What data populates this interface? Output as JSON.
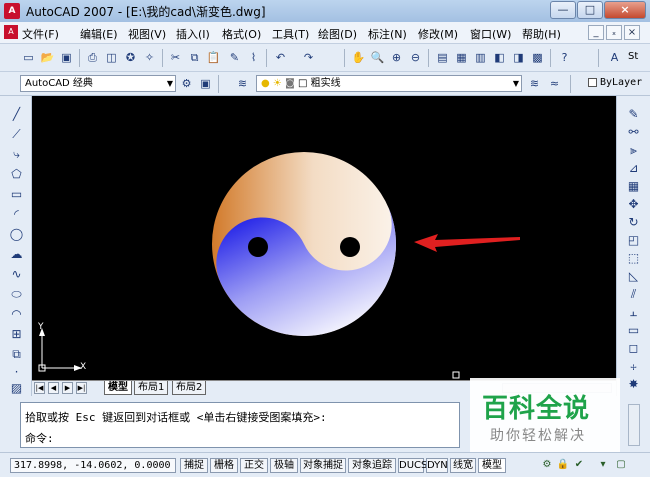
{
  "window": {
    "title": "AutoCAD 2007 - [E:\\我的cad\\渐变色.dwg]",
    "app_icon": "autocad-logo",
    "controls": [
      "—",
      "□",
      "×"
    ]
  },
  "menu": {
    "items": [
      "文件(F)",
      "编辑(E)",
      "视图(V)",
      "插入(I)",
      "格式(O)",
      "工具(T)",
      "绘图(D)",
      "标注(N)",
      "修改(M)",
      "窗口(W)",
      "帮助(H)"
    ],
    "mdi_controls": [
      "_",
      "ₓ",
      "×"
    ]
  },
  "toolbar1": {
    "icons": [
      "new-icon",
      "open-icon",
      "save-icon",
      "print-icon",
      "preview-icon",
      "publish-icon",
      "plot-icon",
      "cut-icon",
      "copy-icon",
      "paste-icon",
      "matchprop-icon",
      "brush-icon",
      "undo-icon",
      "redo-icon",
      "pan-icon",
      "zoom-realtime-icon",
      "zoom-window-icon",
      "zoom-prev-icon",
      "properties-icon",
      "design-center-icon",
      "tool-palettes-icon",
      "sheetset-icon",
      "markup-icon",
      "calculator-icon",
      "help-icon"
    ],
    "text_style_label": "St"
  },
  "toolbar2": {
    "workspace": "AutoCAD 经典",
    "layer": "粗实线",
    "bylayer": "ByLayer"
  },
  "left_tools": [
    "line-icon",
    "xline-icon",
    "polyline-icon",
    "polygon-icon",
    "rectangle-icon",
    "arc-icon",
    "circle-icon",
    "revcloud-icon",
    "spline-icon",
    "ellipse-icon",
    "ellipse-arc-icon",
    "insert-block-icon",
    "make-block-icon",
    "point-icon",
    "hatch-icon"
  ],
  "right_tools": [
    "erase-icon",
    "copy-object-icon",
    "mirror-icon",
    "offset-icon",
    "array-icon",
    "move-icon",
    "rotate-icon",
    "scale-icon",
    "stretch-icon",
    "trim-icon",
    "extend-icon",
    "break-icon",
    "join-icon",
    "chamfer-icon",
    "fillet-icon",
    "explode-icon"
  ],
  "ucs": {
    "x": "X",
    "y": "Y"
  },
  "tabs": {
    "nav": [
      "|◀",
      "◀",
      "▶",
      "▶|"
    ],
    "items": [
      "模型",
      "布局1",
      "布局2"
    ]
  },
  "command": {
    "line1": "拾取或按 Esc 键返回到对话框或 <单击右键接受图案填充>:",
    "line2": "命令:"
  },
  "watermark": {
    "title": "百科全说",
    "subtitle": "助你轻松解决"
  },
  "status": {
    "coords": "317.8998, -14.0602, 0.0000",
    "toggles": [
      "捕捉",
      "栅格",
      "正交",
      "极轴",
      "对象捕捉",
      "对象追踪",
      "DUCS",
      "DYN",
      "线宽",
      "模型"
    ]
  },
  "colors": {
    "canvas": "#000000",
    "gradient_orange": "#d9802e",
    "gradient_blue": "#3a3af0",
    "arrow": "#e02020"
  }
}
